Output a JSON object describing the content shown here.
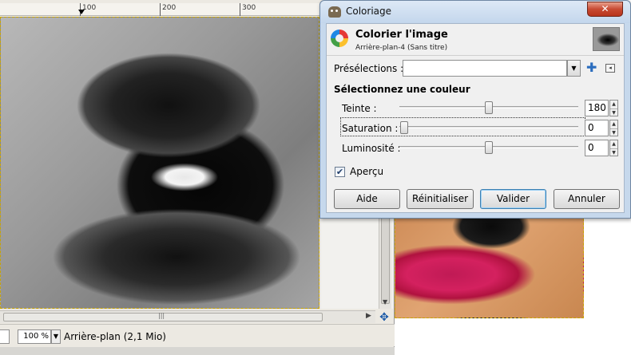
{
  "canvas": {
    "ruler_labels": [
      "100",
      "200",
      "300"
    ],
    "zoom": "100 %",
    "layer_info": "Arrière-plan (2,1 Mio)"
  },
  "dialog": {
    "window_title": "Coloriage",
    "close_glyph": "✕",
    "title": "Colorier l'image",
    "subtitle": "Arrière-plan-4 (Sans titre)",
    "presets_label": "Présélections :",
    "presets_value": "",
    "section_title": "Sélectionnez une couleur",
    "hue": {
      "label": "Teinte :",
      "value": "180",
      "fraction": 0.5
    },
    "saturation": {
      "label": "Saturation :",
      "value": "0",
      "fraction": 0.0
    },
    "lightness": {
      "label": "Luminosité :",
      "value": "0",
      "fraction": 0.5
    },
    "preview_label": "Aperçu",
    "preview_checked": true,
    "buttons": {
      "help": "Aide",
      "reset": "Réinitialiser",
      "ok": "Valider",
      "cancel": "Annuler"
    }
  },
  "icons": [
    "gimp-icon",
    "colorize-icon",
    "add-preset-icon",
    "preset-menu-icon",
    "navigate-icon",
    "close-icon"
  ]
}
